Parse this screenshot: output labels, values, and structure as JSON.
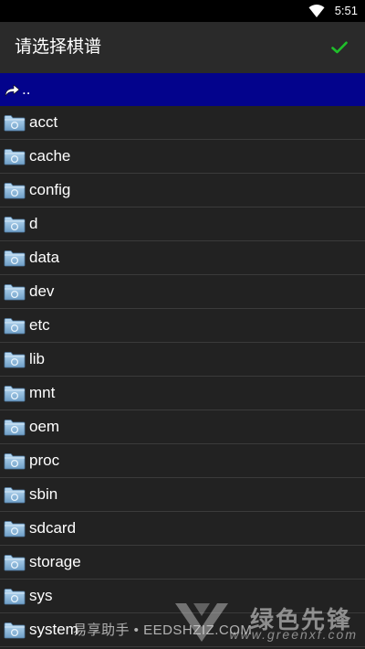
{
  "status_bar": {
    "time": "5:51",
    "wifi_icon": "wifi-icon"
  },
  "app_bar": {
    "title": "请选择棋谱",
    "confirm_icon": "checkmark-icon",
    "confirm_color": "#1fbf2a"
  },
  "file_list": {
    "parent": {
      "label": "..",
      "icon": "parent-directory-icon",
      "highlight_color": "#03038c"
    },
    "folder_icon": "folder-icon",
    "items": [
      {
        "label": "acct"
      },
      {
        "label": "cache"
      },
      {
        "label": "config"
      },
      {
        "label": "d"
      },
      {
        "label": "data"
      },
      {
        "label": "dev"
      },
      {
        "label": "etc"
      },
      {
        "label": "lib"
      },
      {
        "label": "mnt"
      },
      {
        "label": "oem"
      },
      {
        "label": "proc"
      },
      {
        "label": "sbin"
      },
      {
        "label": "sdcard"
      },
      {
        "label": "storage"
      },
      {
        "label": "sys"
      },
      {
        "label": "system"
      }
    ]
  },
  "watermark": {
    "left_text": "易享助手 • EEDSHZIZ.COM",
    "brand": "绿色先锋",
    "url": "www.greenxf.com"
  }
}
